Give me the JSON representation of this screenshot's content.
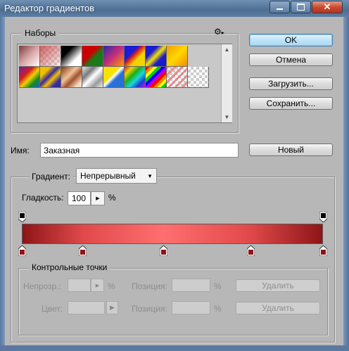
{
  "window": {
    "title": "Редактор градиентов"
  },
  "presets": {
    "label": "Наборы"
  },
  "buttons": {
    "ok": "OK",
    "cancel": "Отмена",
    "load": "Загрузить...",
    "save": "Сохранить...",
    "new": "Новый"
  },
  "name": {
    "label": "Имя:",
    "value": "Заказная"
  },
  "gradient": {
    "label": "Градиент:",
    "type_value": "Непрерывный",
    "smoothness_label": "Гладкость:",
    "smoothness_value": "100",
    "percent": "%",
    "color_stop_positions": [
      0,
      0.2,
      0.47,
      0.76,
      1.0
    ],
    "opacity_stop_positions": [
      0,
      1.0
    ],
    "colors": {
      "dark_red": "#8d1517",
      "bright": "#ff6f70"
    }
  },
  "stops": {
    "label": "Контрольные точки",
    "opacity_label": "Непрозр.:",
    "location_label": "Позиция:",
    "percent": "%",
    "delete": "Удалить",
    "color_label": "Цвет:"
  }
}
